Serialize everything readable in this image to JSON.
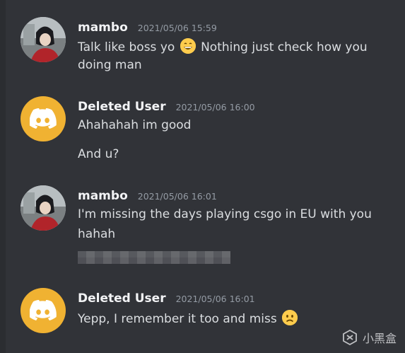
{
  "messages": [
    {
      "username": "mambo",
      "timestamp": "2021/05/06 15:59",
      "lines": [
        "Talk like boss yo",
        "Nothing just check how you",
        "doing man"
      ],
      "emoji_inline": "grinning-face"
    },
    {
      "username": "Deleted User",
      "timestamp": "2021/05/06 16:00",
      "lines": [
        "Ahahahah im good",
        "And u?"
      ]
    },
    {
      "username": "mambo",
      "timestamp": "2021/05/06 16:01",
      "lines": [
        "I'm missing the days playing csgo in EU with you",
        "hahah"
      ]
    },
    {
      "username": "Deleted User",
      "timestamp": "2021/05/06 16:01",
      "lines": [
        "Yepp, I remember it too and miss"
      ],
      "emoji_inline": "frowning-face"
    }
  ],
  "watermark": {
    "text": "小黑盒"
  },
  "colors": {
    "background": "#313338",
    "username": "#f2f3f5",
    "timestamp": "#949ba4",
    "text": "#dbdee1",
    "discord_avatar": "#f0b232"
  }
}
